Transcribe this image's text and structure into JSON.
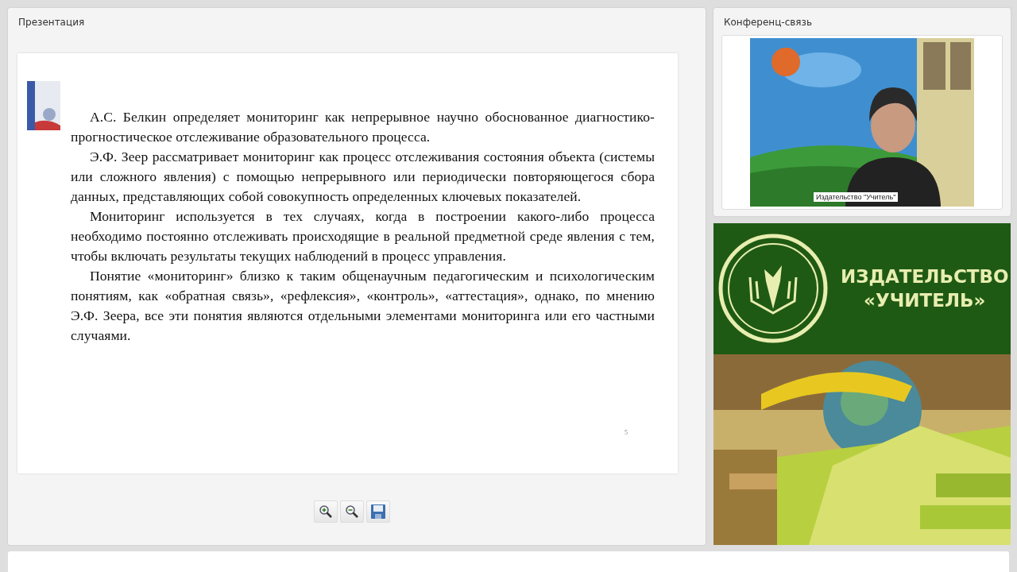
{
  "presentation": {
    "title": "Презентация",
    "slide": {
      "paragraphs": [
        "А.С. Белкин определяет мониторинг как непрерывное научно обоснованное диагностико-прогностическое отслеживание образовательного процесса.",
        "Э.Ф. Зеер рассматривает мониторинг как процесс отслеживания состояния объекта (системы или сложного явления) с помощью непрерывного или периодически повторяющегося сбора данных, представляющих собой совокупность определенных ключевых показателей.",
        "Мониторинг используется в тех случаях, когда в построении какого-либо процесса необходимо постоянно отслеживать происходящие в реальной предметной среде явления с тем, чтобы включать результаты текущих наблюдений в процесс управления.",
        "Понятие «мониторинг» близко к таким общенаучным педагогическим и психологическим понятиям, как «обратная связь», «рефлексия», «контроль», «аттестация», однако, по мнению Э.Ф. Зеера, все эти понятия являются отдельными элементами мониторинга или его частными случаями."
      ],
      "page_number": "5"
    },
    "toolbar": [
      {
        "kind": "zoom-in"
      },
      {
        "kind": "zoom-out"
      },
      {
        "kind": "save"
      }
    ]
  },
  "conference": {
    "title": "Конференц-связь",
    "video": {
      "kind": "picture",
      "caption": "Издательство \"Учитель\""
    }
  },
  "banner": {
    "line_1": "ИЗДАТЕЛЬСТВО",
    "line_2": "«УЧИТЕЛЬ»"
  }
}
